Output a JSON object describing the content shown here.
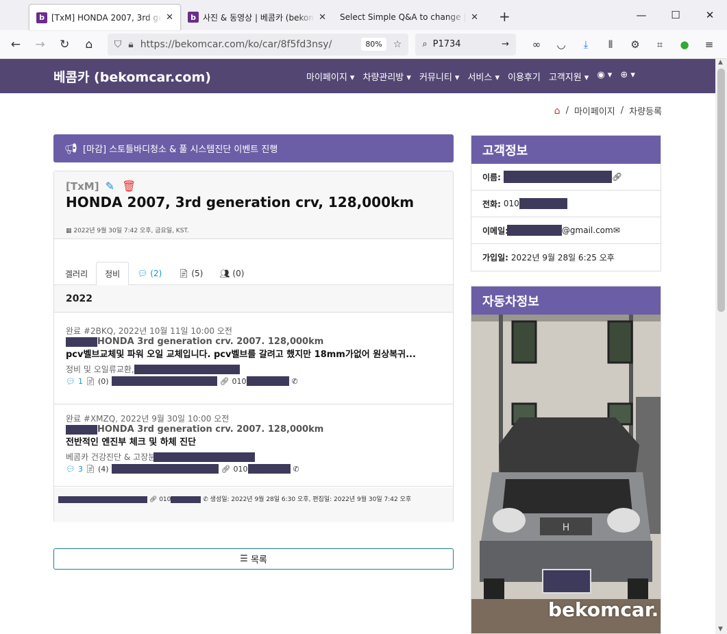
{
  "browser": {
    "tabs": [
      {
        "title": "[TxM] HONDA 2007, 3rd generation crv, 128,000km",
        "active": true
      },
      {
        "title": "사진 & 동영상 | 베콤카 (bekomcar.com)",
        "active": false
      },
      {
        "title": "Select Simple Q&A to change | bekomcar",
        "active": false
      }
    ],
    "url": "https://bekomcar.com/ko/car/8f5fd3nsy/",
    "zoom": "80%",
    "search": "P1734"
  },
  "site": {
    "brand": "베콤카 (bekomcar.com)",
    "menu": [
      "마이페이지 ▾",
      "차량관리방 ▾",
      "커뮤니티 ▾",
      "서비스 ▾",
      "이용후기",
      "고객지원 ▾",
      "◉ ▾",
      "⊕ ▾"
    ]
  },
  "breadcrumb": {
    "items": [
      "마이페이지",
      "차량등록"
    ]
  },
  "announcement": "[마감] 스토틀바디청소 & 풀 시스템진단 이벤트 진행",
  "car": {
    "tag": "[TxM]",
    "title": "HONDA 2007, 3rd generation crv, 128,000km",
    "datetime": "2022년 9월 30일 7:42 오후, 금요일, KST."
  },
  "tabs": {
    "gallery": "겔러리",
    "maintenance": "정비",
    "comments": "(2)",
    "docs": "(5)",
    "users": "(0)"
  },
  "year": "2022",
  "entries": [
    {
      "meta": "완료 #2BKQ, 2022년 10월 11일 10:00 오전",
      "car": "HONDA 3rd generation crv. 2007. 128,000km",
      "desc": "pcv벨브교체및 파워 오일 교체입니다. pcv벨브를 갈려고 했지만 18mm가없어 원상복귀...",
      "category": "정비 및 오일류교환,",
      "comments": "1",
      "docs": "(0)",
      "phone": "010"
    },
    {
      "meta": "완료 #XMZQ, 2022년 9월 30일 10:00 오전",
      "car": "HONDA 3rd generation crv. 2007. 128,000km",
      "desc": "전반적인 엔진부 체크 및 하체 진단",
      "category": "베콤카 건강진단 & 고장분석",
      "comments": "3",
      "docs": "(4)",
      "phone": "010"
    }
  ],
  "footer": {
    "phone": "010",
    "created": "생성일: 2022년 9월 28일 6:30 오후, 편집일: 2022년 9월 30일 7:42 오후"
  },
  "list_button": "목록",
  "customer": {
    "heading": "고객정보",
    "name_label": "이름:",
    "phone_label": "전화:",
    "phone_value": "010",
    "email_label": "이메일:",
    "email_domain": "@gmail.com",
    "joined_label": "가입일:",
    "joined_value": "2022년 9월 28일 6:25 오후"
  },
  "vehicle": {
    "heading": "자동차정보",
    "watermark": "bekomcar."
  }
}
